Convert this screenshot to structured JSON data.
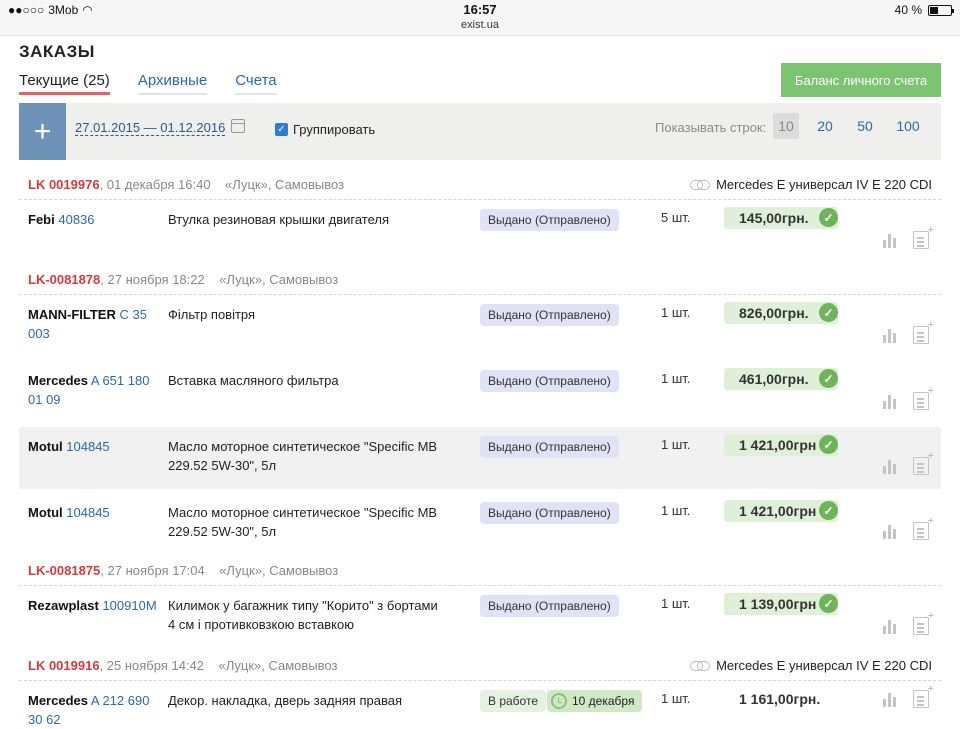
{
  "status_bar": {
    "carrier": "3Mob",
    "time": "16:57",
    "url": "exist.ua",
    "battery": "40 %",
    "battery_level": 0.4
  },
  "page_title": "ЗАКАЗЫ",
  "tabs": [
    {
      "label": "Текущие (25)",
      "active": true
    },
    {
      "label": "Архивные",
      "active": false
    },
    {
      "label": "Счета",
      "active": false
    }
  ],
  "balance_button": "Баланс личного счета",
  "toolbar": {
    "add_label": "+",
    "date_range": "27.01.2015 — 01.12.2016",
    "group_label": "Группировать",
    "group_checked": true,
    "rows_label": "Показывать строк:",
    "rows_options": [
      "10",
      "20",
      "50",
      "100"
    ],
    "rows_selected": "10"
  },
  "orders": [
    {
      "number": "LK 0019976",
      "date": ", 01 декабря 16:40",
      "delivery": "«Луцк», Самовывоз",
      "car": "Mercedes E универсал IV E 220 CDI",
      "items": [
        {
          "brand": "Febi",
          "code": "40836",
          "desc": "Втулка резиновая крышки двигателя",
          "status": "Выдано (Отправлено)",
          "qty": "5 шт.",
          "price": "145,00грн."
        }
      ]
    },
    {
      "number": "LK-0081878",
      "date": ", 27 ноября 18:22",
      "delivery": "«Луцк», Самовывоз",
      "car": "",
      "items": [
        {
          "brand": "MANN-FILTER",
          "code": "C 35 003",
          "desc": "Фільтр повітря",
          "status": "Выдано (Отправлено)",
          "qty": "1 шт.",
          "price": "826,00грн."
        },
        {
          "brand": "Mercedes",
          "code": "A 651 180 01 09",
          "desc": "Вставка масляного фильтра",
          "status": "Выдано (Отправлено)",
          "qty": "1 шт.",
          "price": "461,00грн."
        },
        {
          "brand": "Motul",
          "code": "104845",
          "desc": "Масло моторное синтетическое \"Specific MB 229.52 5W-30\", 5л",
          "status": "Выдано (Отправлено)",
          "qty": "1 шт.",
          "price": "1 421,00грн"
        },
        {
          "brand": "Motul",
          "code": "104845",
          "desc": "Масло моторное синтетическое \"Specific MB 229.52 5W-30\", 5л",
          "status": "Выдано (Отправлено)",
          "qty": "1 шт.",
          "price": "1 421,00грн"
        }
      ]
    },
    {
      "number": "LK-0081875",
      "date": ", 27 ноября 17:04",
      "delivery": "«Луцк», Самовывоз",
      "car": "",
      "items": [
        {
          "brand": "Rezawplast",
          "code": "100910M",
          "desc": "Килимок у багажник типу \"Корито\" з бортами 4 см і противковзкою вставкою",
          "status": "Выдано (Отправлено)",
          "qty": "1 шт.",
          "price": "1 139,00грн"
        }
      ]
    },
    {
      "number": "LK 0019916",
      "date": ", 25 ноября 14:42",
      "delivery": "«Луцк», Самовывоз",
      "car": "Mercedes E универсал IV E 220 CDI",
      "items": [
        {
          "brand": "Mercedes",
          "code": "A 212 690 30 62",
          "desc": "Декор. накладка, дверь задняя правая",
          "status": "В работе",
          "status_date": "10 декабря",
          "qty": "1 шт.",
          "price": "1 161,00грн."
        }
      ]
    }
  ]
}
